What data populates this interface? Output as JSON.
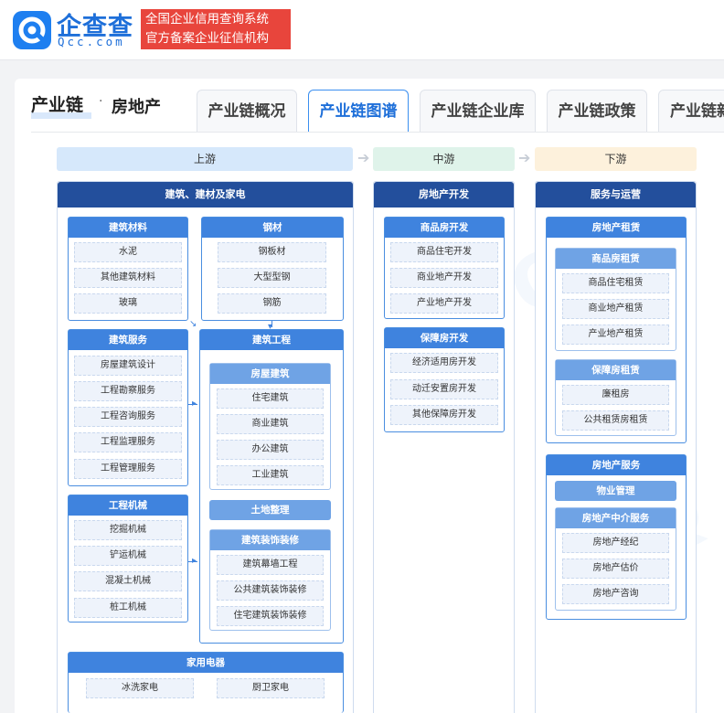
{
  "header": {
    "logo_name": "企查查",
    "logo_domain": "Qcc.com",
    "banner_line1": "全国企业信用查询系统",
    "banner_line2": "官方备案企业征信机构"
  },
  "page": {
    "title": "产业链",
    "separator": "·",
    "industry": "房地产"
  },
  "tabs": [
    {
      "label": "产业链概况"
    },
    {
      "label": "产业链图谱"
    },
    {
      "label": "产业链企业库"
    },
    {
      "label": "产业链政策"
    },
    {
      "label": "产业链新"
    }
  ],
  "stages": {
    "upstream": "上游",
    "midstream": "中游",
    "downstream": "下游",
    "arrow": "➔"
  },
  "upstream": {
    "title": "建筑、建材及家电",
    "materials": {
      "title": "建筑材料",
      "items": [
        "水泥",
        "其他建筑材料",
        "玻璃"
      ]
    },
    "steel": {
      "title": "钢材",
      "items": [
        "钢板材",
        "大型型钢",
        "钢筋"
      ]
    },
    "services": {
      "title": "建筑服务",
      "items": [
        "房屋建筑设计",
        "工程勘察服务",
        "工程咨询服务",
        "工程监理服务",
        "工程管理服务"
      ]
    },
    "construction": {
      "title": "建筑工程",
      "housing": {
        "title": "房屋建筑",
        "items": [
          "住宅建筑",
          "商业建筑",
          "办公建筑",
          "工业建筑"
        ]
      },
      "land": "土地整理",
      "decoration": {
        "title": "建筑装饰装修",
        "items": [
          "建筑幕墙工程",
          "公共建筑装饰装修",
          "住宅建筑装饰装修"
        ]
      }
    },
    "machinery": {
      "title": "工程机械",
      "items": [
        "挖掘机械",
        "铲运机械",
        "混凝土机械",
        "桩工机械"
      ]
    },
    "appliances": {
      "title": "家用电器",
      "items": [
        "冰洗家电",
        "厨卫家电"
      ]
    }
  },
  "midstream": {
    "title": "房地产开发",
    "commercial": {
      "title": "商品房开发",
      "items": [
        "商品住宅开发",
        "商业地产开发",
        "产业地产开发"
      ]
    },
    "affordable": {
      "title": "保障房开发",
      "items": [
        "经济适用房开发",
        "动迁安置房开发",
        "其他保障房开发"
      ]
    }
  },
  "downstream": {
    "title": "服务与运营",
    "rental": {
      "title": "房地产租赁",
      "commercial": {
        "title": "商品房租赁",
        "items": [
          "商品住宅租赁",
          "商业地产租赁",
          "产业地产租赁"
        ]
      },
      "affordable": {
        "title": "保障房租赁",
        "items": [
          "廉租房",
          "公共租赁房租赁"
        ]
      }
    },
    "services": {
      "title": "房地产服务",
      "property": "物业管理",
      "agency": {
        "title": "房地产中介服务",
        "items": [
          "房地产经纪",
          "房地产估价",
          "房地产咨询"
        ]
      }
    }
  },
  "colors": {
    "brand": "#1e6fd9",
    "banner_red": "#e8453c",
    "column_header": "#234f9c",
    "group_header": "#3f83de",
    "sub_header": "#6fa3e5",
    "upstream_stage": "#d6e8fb",
    "midstream_stage": "#dff3ea",
    "downstream_stage": "#fdf1dc"
  }
}
